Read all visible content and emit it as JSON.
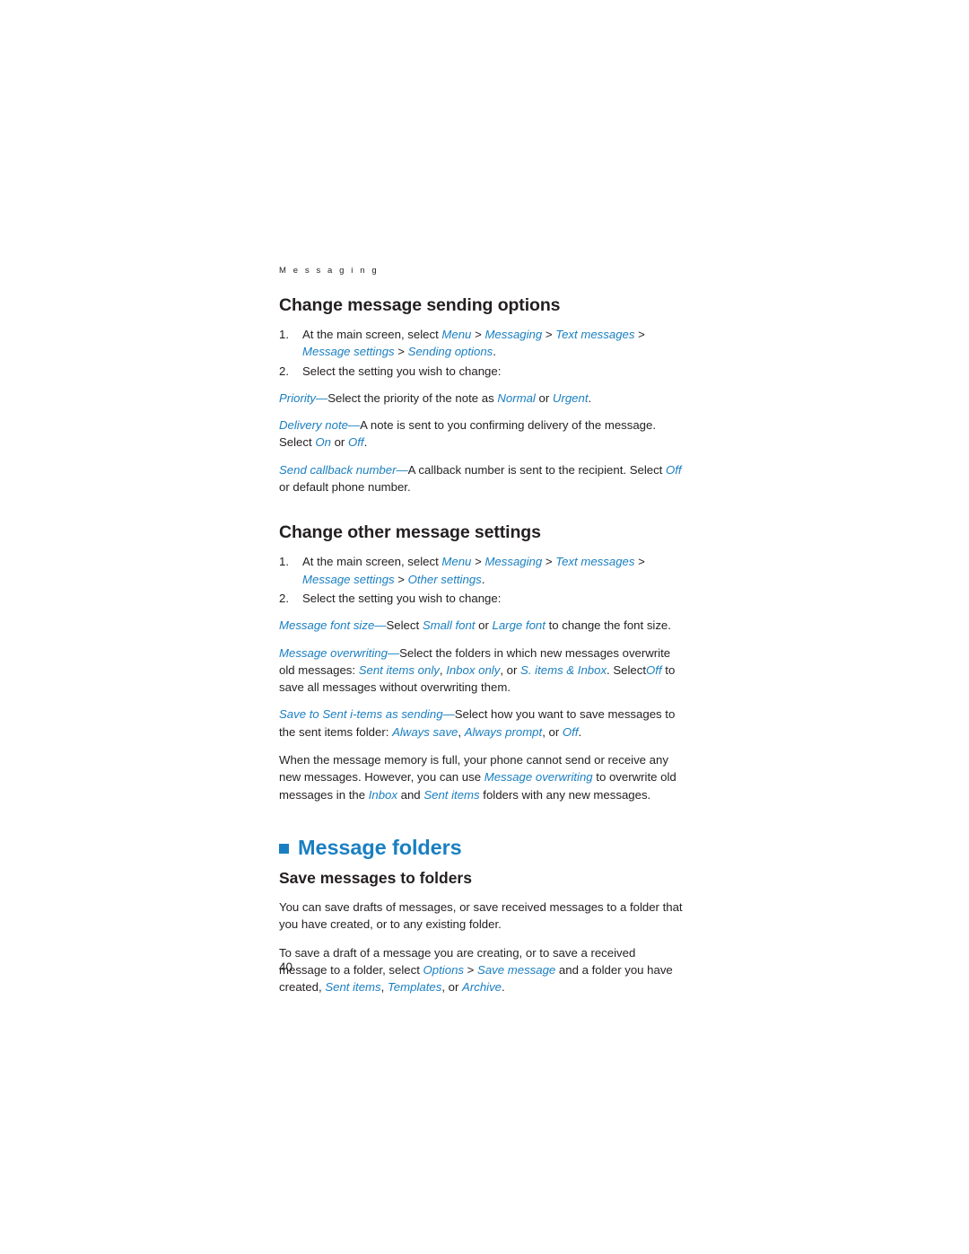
{
  "running_head": "M e s s a g i n g",
  "page_number": "40",
  "colors": {
    "link_blue": "#1a7fc1",
    "body_black": "#231f20"
  },
  "section1": {
    "heading": "Change message sending options",
    "steps": [
      {
        "num": "1.",
        "text_parts": [
          {
            "t": "At the main screen, select ",
            "style": "plain"
          },
          {
            "t": "Menu",
            "style": "bi"
          },
          {
            "t": " > ",
            "style": "plain"
          },
          {
            "t": "Messaging",
            "style": "bi"
          },
          {
            "t": " > ",
            "style": "plain"
          },
          {
            "t": "Text messages",
            "style": "bi"
          },
          {
            "t": " > ",
            "style": "plain"
          },
          {
            "t": "Message settings",
            "style": "bi"
          },
          {
            "t": " > ",
            "style": "plain"
          },
          {
            "t": "Sending options",
            "style": "bi"
          },
          {
            "t": ".",
            "style": "plain"
          }
        ],
        "plain": "At the main screen, select Menu > Messaging > Text messages > Message settings > Sending options."
      },
      {
        "num": "2.",
        "plain": "Select the setting you wish to change:"
      }
    ],
    "settings": [
      "Priority—Select the priority of the note as Normal or Urgent.",
      "Delivery note—A note is sent to you confirming delivery of the message. Select On or Off.",
      "Send callback number—A callback number is sent to the recipient. Select Off or default phone number."
    ]
  },
  "section2": {
    "heading": "Change other message settings",
    "steps": [
      {
        "num": "1.",
        "plain": "At the main screen, select Menu > Messaging > Text messages > Message settings > Other settings."
      },
      {
        "num": "2.",
        "plain": "Select the setting you wish to change:"
      }
    ],
    "settings": [
      "Message font size—Select Small font or Large font to change the font size.",
      "Message overwriting—Select the folders in which new messages overwrite old messages: Sent items only, Inbox only, or S. items & Inbox. Select Off to save all messages without overwriting them.",
      "Save to Sent i-tems as sending—Select how you want to save messages to the sent items folder: Always save, Always prompt, or Off."
    ],
    "note": "When the message memory is full, your phone cannot send or receive any new messages. However, you can use Message overwriting to overwrite old messages in the Inbox and Sent items folders with any new messages."
  },
  "chapter": {
    "title": "Message folders",
    "bullet_icon": "square-bullet-icon"
  },
  "section3": {
    "heading": "Save messages to folders",
    "paragraph1": "You can save drafts of messages, or save received messages to a folder that you have created, or to any existing folder.",
    "paragraph2": "To save a draft of a message you are creating, or to save a received message to a folder, select Options > Save message and a folder you have created, Sent items, Templates, or Archive."
  }
}
